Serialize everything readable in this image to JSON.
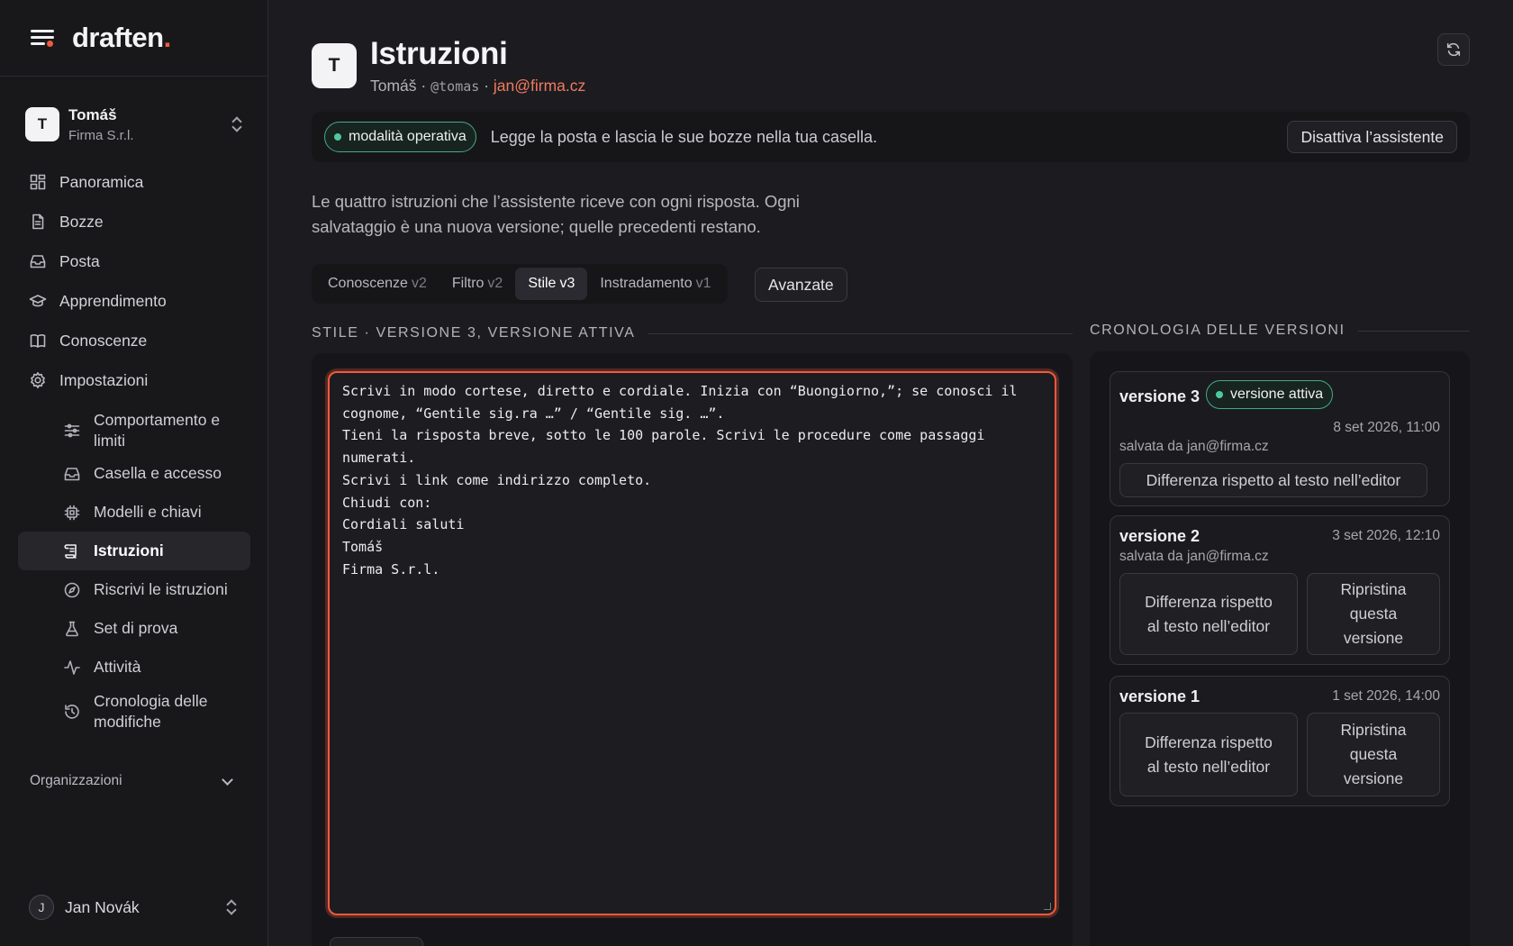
{
  "brand": {
    "logo_text": "draften",
    "logo_dot": ".",
    "accent": "#ef5a3c"
  },
  "account": {
    "initial": "T",
    "name": "Tomáš",
    "org": "Firma S.r.l."
  },
  "nav": {
    "items": [
      {
        "label": "Panoramica",
        "icon": "grid-icon"
      },
      {
        "label": "Bozze",
        "icon": "file-icon"
      },
      {
        "label": "Posta",
        "icon": "inbox-icon"
      },
      {
        "label": "Apprendimento",
        "icon": "graduation-cap-icon"
      },
      {
        "label": "Conoscenze",
        "icon": "book-icon"
      },
      {
        "label": "Impostazioni",
        "icon": "gear-icon"
      }
    ],
    "sub_items": [
      {
        "label": "Comportamento e limiti",
        "icon": "sliders-icon"
      },
      {
        "label": "Casella e accesso",
        "icon": "inbox-icon"
      },
      {
        "label": "Modelli e chiavi",
        "icon": "chip-icon"
      },
      {
        "label": "Istruzioni",
        "icon": "scroll-icon"
      },
      {
        "label": "Riscrivi le istruzioni",
        "icon": "compass-icon"
      },
      {
        "label": "Set di prova",
        "icon": "flask-icon"
      },
      {
        "label": "Attività",
        "icon": "activity-icon"
      },
      {
        "label": "Cronologia delle modifiche",
        "icon": "history-icon"
      }
    ],
    "organizations_label": "Organizzazioni"
  },
  "user": {
    "initial": "J",
    "name": "Jan Novák"
  },
  "header": {
    "initial": "T",
    "title": "Istruzioni",
    "name": "Tomáš",
    "sep": "·",
    "handle": "@tomas",
    "email": "jan@firma.cz"
  },
  "mode": {
    "badge": "modalità operativa",
    "text": "Legge la posta e lascia le sue bozze nella tua casella.",
    "deactivate_label": "Disattiva l’assistente",
    "status_color": "#4fc99b"
  },
  "description": "Le quattro istruzioni che l’assistente riceve con ogni risposta. Ogni salvataggio è una nuova versione; quelle precedenti restano.",
  "tabs": [
    {
      "label": "Conoscenze",
      "version": "v2"
    },
    {
      "label": "Filtro",
      "version": "v2"
    },
    {
      "label": "Stile",
      "version": "v3"
    },
    {
      "label": "Instradamento",
      "version": "v1"
    }
  ],
  "advanced_label": "Avanzate",
  "editor": {
    "heading": "STILE · VERSIONE 3, VERSIONE ATTIVA",
    "text": "Scrivi in modo cortese, diretto e cordiale. Inizia con “Buongiorno,”; se conosci il cognome, “Gentile sig.ra …” / “Gentile sig. …”.\nTieni la risposta breve, sotto le 100 parole. Scrivi le procedure come passaggi numerati.\nScrivi i link come indirizzo completo.\nChiudi con:\nCordiali saluti\nTomáš\nFirma S.r.l."
  },
  "history": {
    "heading": "CRONOLOGIA DELLE VERSIONI",
    "versions": [
      {
        "name": "versione 3",
        "badge": "versione attiva",
        "date": "8 set 2026, 11:00",
        "saved_by": "salvata da jan@firma.cz",
        "diff_label": "Differenza rispetto al testo nell’editor"
      },
      {
        "name": "versione 2",
        "date": "3 set 2026, 12:10",
        "saved_by": "salvata da jan@firma.cz",
        "diff_label": "Differenza rispetto al testo nell’editor",
        "restore_label": "Ripristina questa versione"
      },
      {
        "name": "versione 1",
        "date": "1 set 2026, 14:00",
        "diff_label": "Differenza rispetto al testo nell’editor",
        "restore_label": "Ripristina questa versione"
      }
    ]
  }
}
